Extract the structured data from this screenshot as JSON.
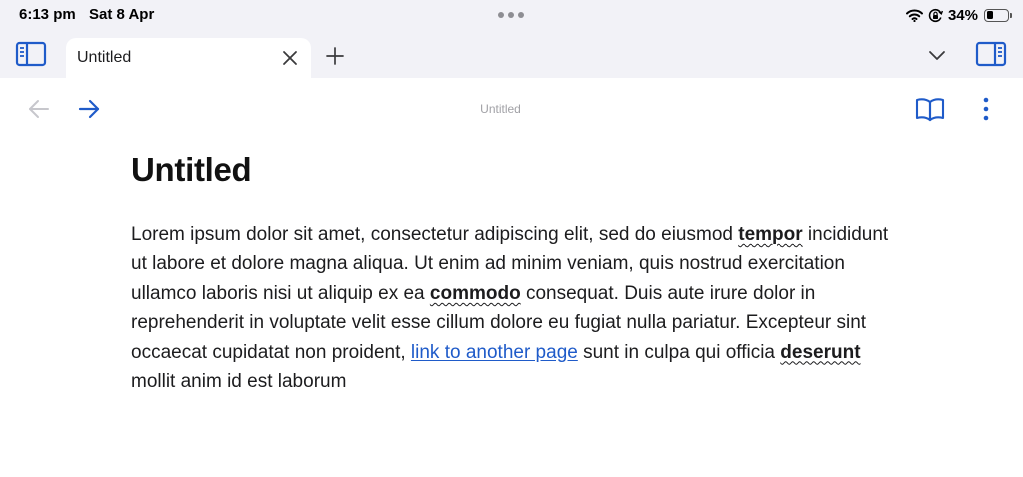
{
  "status_bar": {
    "time": "6:13 pm",
    "date": "Sat 8 Apr",
    "battery_percent": "34%",
    "battery_level": 0.34
  },
  "tab_bar": {
    "tabs": [
      {
        "title": "Untitled",
        "active": true
      }
    ]
  },
  "nav_bar": {
    "title": "Untitled"
  },
  "document": {
    "heading": "Untitled",
    "paragraph": {
      "t1": "Lorem ipsum dolor sit amet, consectetur adipiscing elit, sed do eiusmod ",
      "w1": "tempor",
      "t2": " incididunt ut labore et dolore magna aliqua. Ut enim ad minim veniam, quis nostrud exercitation ullamco laboris nisi ut aliquip ex ea ",
      "w2": "commodo",
      "t3": " consequat. Duis aute irure dolor in reprehenderit in voluptate velit esse cillum dolore eu fugiat nulla pariatur. Excepteur sint occaecat cupidatat non proident, ",
      "link": "link to another page",
      "t4": " sunt in culpa qui officia ",
      "w3": "deserunt",
      "t5": " mollit anim id est laborum"
    }
  },
  "icons": {
    "sidebar": "sidebar-left-icon",
    "close": "close-icon",
    "new_tab": "plus-icon",
    "tab_menu": "chevron-down-icon",
    "inspector": "sidebar-right-icon",
    "back": "arrow-left-icon",
    "forward": "arrow-right-icon",
    "reader": "book-icon",
    "more": "ellipsis-vertical-icon",
    "wifi": "wifi-icon",
    "orientation_lock": "orientation-lock-icon",
    "battery": "battery-icon"
  },
  "colors": {
    "accent": "#1f5bc9",
    "disabled": "#c7c7cc",
    "chrome_bg": "#f2f2f7",
    "link": "#1f5bc9"
  }
}
